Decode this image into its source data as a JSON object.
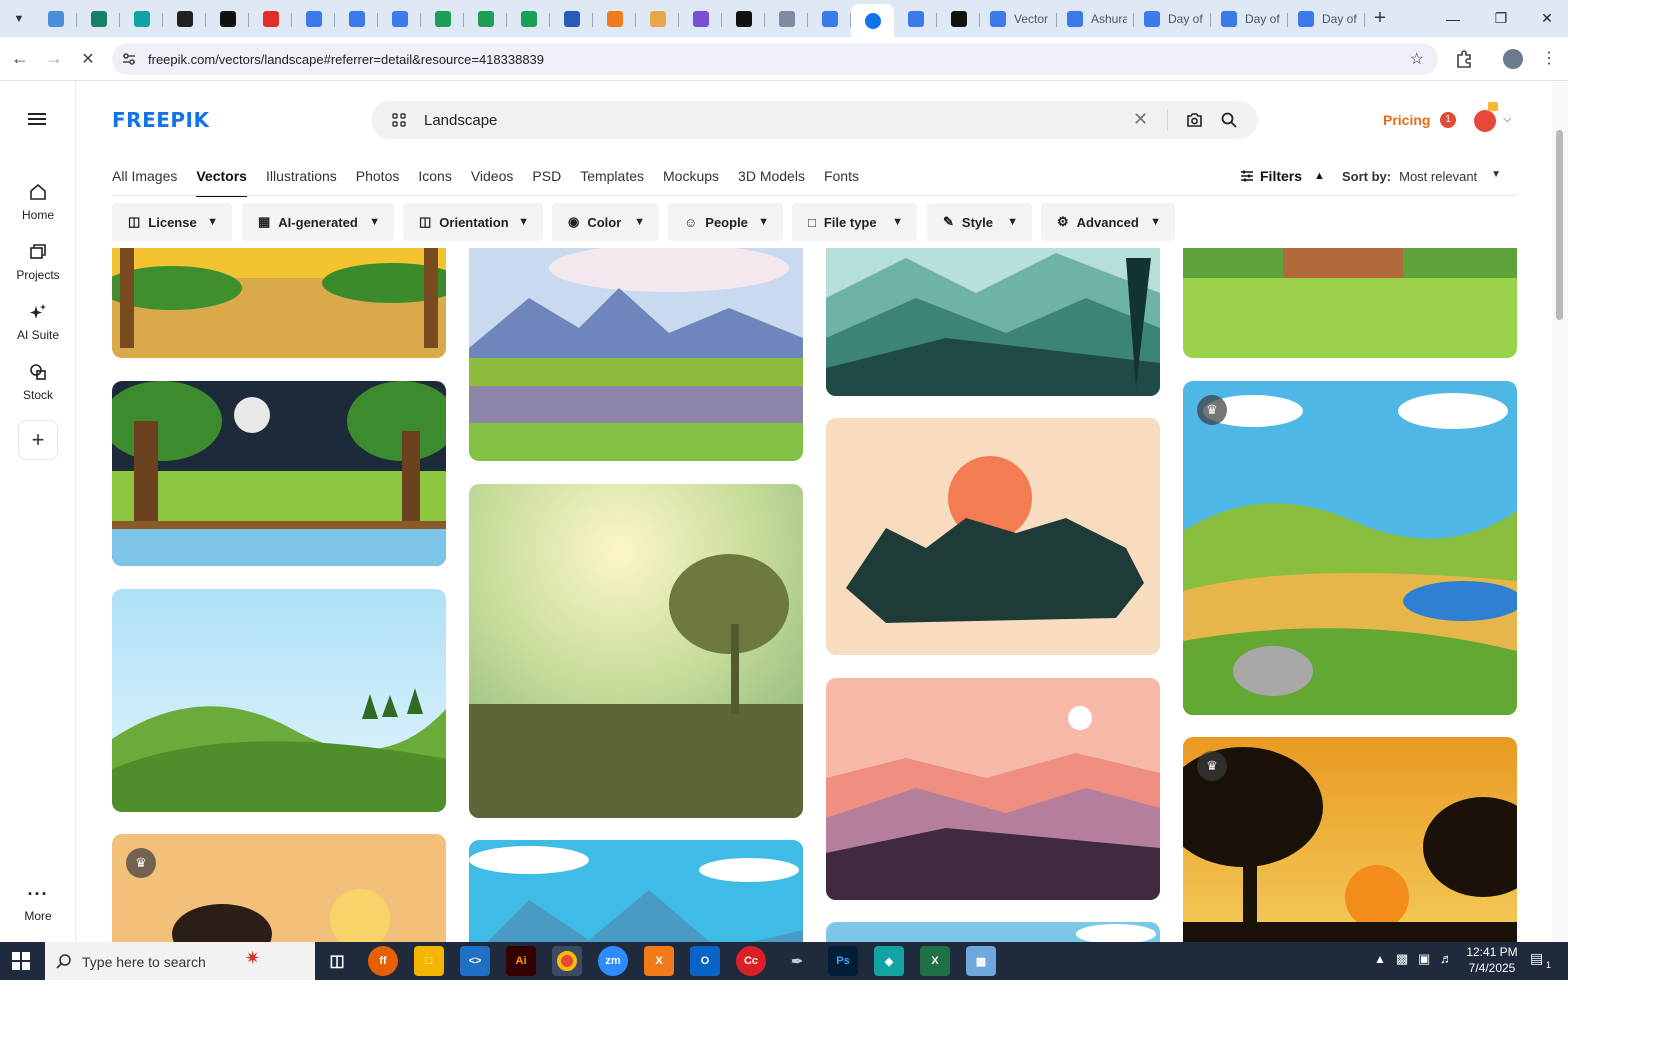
{
  "browser": {
    "tabs": [
      {
        "icon": "world-icon",
        "color": "#4a90d9"
      },
      {
        "icon": "shield-icon",
        "color": "#1a7f64"
      },
      {
        "icon": "arrow-icon",
        "color": "#10a3a3"
      },
      {
        "icon": "openai-icon",
        "color": "#222222"
      },
      {
        "icon": "bolt-icon",
        "color": "#111111"
      },
      {
        "icon": "youtube-icon",
        "color": "#e52d27"
      },
      {
        "icon": "docs-icon",
        "color": "#3b7ae8"
      },
      {
        "icon": "docs-icon",
        "color": "#3b7ae8"
      },
      {
        "icon": "docs-icon",
        "color": "#3b7ae8"
      },
      {
        "icon": "sheets-icon",
        "color": "#1e9e57"
      },
      {
        "icon": "sheets-icon",
        "color": "#1e9e57"
      },
      {
        "icon": "sheets-icon",
        "color": "#1e9e57"
      },
      {
        "icon": "word-icon",
        "color": "#2b5bb8"
      },
      {
        "icon": "xampp-icon",
        "color": "#f27a1a"
      },
      {
        "icon": "bird-icon",
        "color": "#e8a64a"
      },
      {
        "icon": "code-icon",
        "color": "#7a4fd1"
      },
      {
        "icon": "ai-icon",
        "color": "#111111"
      },
      {
        "icon": "grid-icon",
        "color": "#7d8ba3"
      },
      {
        "icon": "forms-icon",
        "color": "#3b7ae8"
      }
    ],
    "active_tab_icon": "freepik-icon",
    "after_tabs": [
      {
        "icon": "forms-icon",
        "color": "#3b7ae8"
      },
      {
        "icon": "medium-icon",
        "color": "#111111"
      }
    ],
    "titled_tabs": [
      {
        "title": "Vector",
        "color": "#3b7ae8"
      },
      {
        "title": "Ashura",
        "color": "#3b7ae8"
      },
      {
        "title": "Day of",
        "color": "#3b7ae8"
      },
      {
        "title": "Day of",
        "color": "#3b7ae8"
      },
      {
        "title": "Day of",
        "color": "#3b7ae8"
      }
    ],
    "url": "freepik.com/vectors/landscape#referrer=detail&resource=418338839"
  },
  "sidebar": {
    "items": [
      {
        "label": "Home",
        "icon": "home-icon"
      },
      {
        "label": "Projects",
        "icon": "projects-icon"
      },
      {
        "label": "AI Suite",
        "icon": "sparkle-icon"
      },
      {
        "label": "Stock",
        "icon": "stock-icon"
      }
    ],
    "more_label": "More"
  },
  "header": {
    "logo": "FREEPIK",
    "search_value": "Landscape",
    "pricing": "Pricing",
    "notification_count": "1"
  },
  "categories": [
    {
      "label": "All Images",
      "active": false
    },
    {
      "label": "Vectors",
      "active": true
    },
    {
      "label": "Illustrations",
      "active": false
    },
    {
      "label": "Photos",
      "active": false
    },
    {
      "label": "Icons",
      "active": false
    },
    {
      "label": "Videos",
      "active": false
    },
    {
      "label": "PSD",
      "active": false
    },
    {
      "label": "Templates",
      "active": false
    },
    {
      "label": "Mockups",
      "active": false
    },
    {
      "label": "3D Models",
      "active": false
    },
    {
      "label": "Fonts",
      "active": false
    }
  ],
  "filters": {
    "label": "Filters",
    "sort_label": "Sort by:",
    "sort_value": "Most relevant",
    "pills": [
      "License",
      "AI-generated",
      "Orientation",
      "Color",
      "People",
      "File type",
      "Style",
      "Advanced"
    ]
  },
  "taskbar": {
    "search_placeholder": "Type here to search",
    "time": "12:41 PM",
    "date": "7/4/2025",
    "notifications": "1"
  }
}
